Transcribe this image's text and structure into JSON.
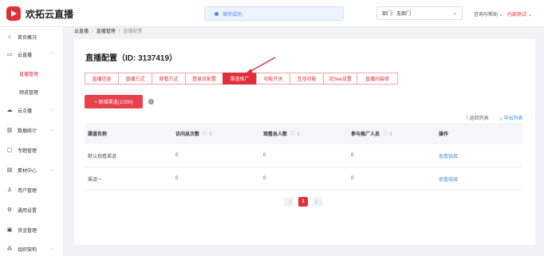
{
  "header": {
    "app_name": "欢拓云直播",
    "toast": "保存成功",
    "dept_select": "部门：无部门",
    "help": "咨询与帮助",
    "user": "内部测试",
    "brand_color": "#e02e3a"
  },
  "sidebar": {
    "items": [
      {
        "icon": "home-icon",
        "label": "首页概况",
        "expanded": null
      },
      {
        "icon": "live-icon",
        "label": "云直播",
        "expanded": true
      },
      {
        "icon": "",
        "label": "直播管理",
        "sub": true,
        "active": true
      },
      {
        "icon": "",
        "label": "频道管理",
        "sub": true
      },
      {
        "icon": "cloud-icon",
        "label": "云点播",
        "expanded": false
      },
      {
        "icon": "stats-icon",
        "label": "数据统计",
        "expanded": false
      },
      {
        "icon": "topic-icon",
        "label": "专题管理",
        "expanded": null
      },
      {
        "icon": "material-icon",
        "label": "素材中心",
        "expanded": false
      },
      {
        "icon": "user-icon",
        "label": "用户管理",
        "expanded": null
      },
      {
        "icon": "settings-icon",
        "label": "通用设置",
        "expanded": null
      },
      {
        "icon": "funds-icon",
        "label": "资金管理",
        "expanded": null
      },
      {
        "icon": "org-icon",
        "label": "组织架构",
        "expanded": false
      }
    ]
  },
  "breadcrumb": [
    "云直播",
    "直播管理",
    "直播配置"
  ],
  "page": {
    "title": "直播配置（ID: 3137419）",
    "tabs": [
      "直播信息",
      "直播方式",
      "观看方式",
      "登录页配置",
      "渠道推广",
      "功能开关",
      "互动功能",
      "流See设置",
      "直播间装修"
    ],
    "active_tab": 4,
    "add_button": "+ 新增渠道(1/200)",
    "back_link": "〈 返回列表",
    "export_link": "⤓ 导出列表"
  },
  "table": {
    "columns": [
      "渠道名称",
      "访问总次数",
      "观看总人数",
      "参与推广人员",
      "操作"
    ],
    "rows": [
      {
        "name": "默认观看渠道",
        "visits": "0",
        "viewers": "0",
        "promoters": "0",
        "action": "查看链接"
      },
      {
        "name": "渠道一",
        "visits": "0",
        "viewers": "0",
        "promoters": "0",
        "action": "查看链接"
      }
    ]
  },
  "pagination": {
    "current": "1",
    "prev": "〈",
    "next": "〉"
  }
}
